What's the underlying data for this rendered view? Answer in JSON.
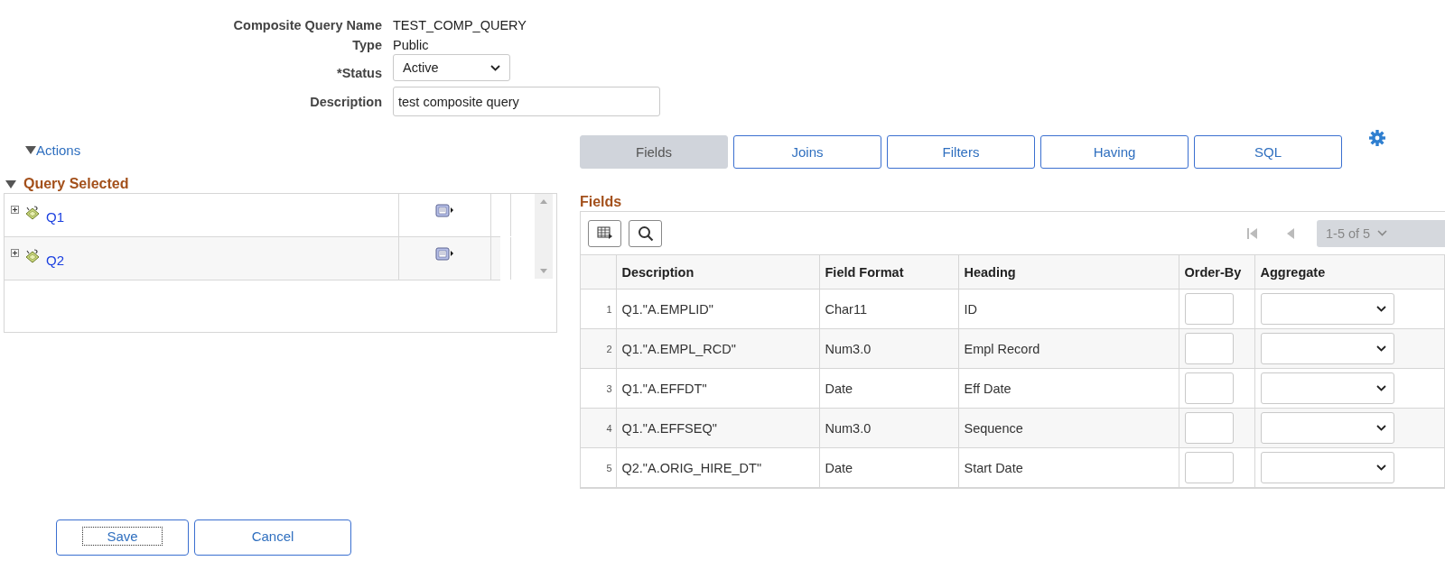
{
  "form": {
    "name_label": "Composite Query Name",
    "name_value": "TEST_COMP_QUERY",
    "type_label": "Type",
    "type_value": "Public",
    "status_label": "*Status",
    "status_value": "Active",
    "description_label": "Description",
    "description_value": "test composite query"
  },
  "actions": {
    "label": "Actions"
  },
  "query_selected": {
    "title": "Query Selected",
    "items": [
      {
        "label": "Q1"
      },
      {
        "label": "Q2"
      }
    ]
  },
  "tabs": [
    {
      "label": "Fields",
      "selected": true
    },
    {
      "label": "Joins",
      "selected": false
    },
    {
      "label": "Filters",
      "selected": false
    },
    {
      "label": "Having",
      "selected": false
    },
    {
      "label": "SQL",
      "selected": false
    }
  ],
  "fields_grid": {
    "title": "Fields",
    "pager": "1-5 of 5",
    "columns": [
      "Description",
      "Field Format",
      "Heading",
      "Order-By",
      "Aggregate"
    ],
    "rows": [
      {
        "number": "1",
        "description": "Q1.\"A.EMPLID\"",
        "field_format": "Char11",
        "heading": "ID"
      },
      {
        "number": "2",
        "description": "Q1.\"A.EMPL_RCD\"",
        "field_format": "Num3.0",
        "heading": "Empl Record"
      },
      {
        "number": "3",
        "description": "Q1.\"A.EFFDT\"",
        "field_format": "Date",
        "heading": "Eff Date"
      },
      {
        "number": "4",
        "description": "Q1.\"A.EFFSEQ\"",
        "field_format": "Num3.0",
        "heading": "Sequence"
      },
      {
        "number": "5",
        "description": "Q2.\"A.ORIG_HIRE_DT\"",
        "field_format": "Date",
        "heading": "Start Date"
      }
    ]
  },
  "buttons": [
    {
      "label": "Save",
      "focused": true
    },
    {
      "label": "Cancel",
      "focused": false
    }
  ]
}
